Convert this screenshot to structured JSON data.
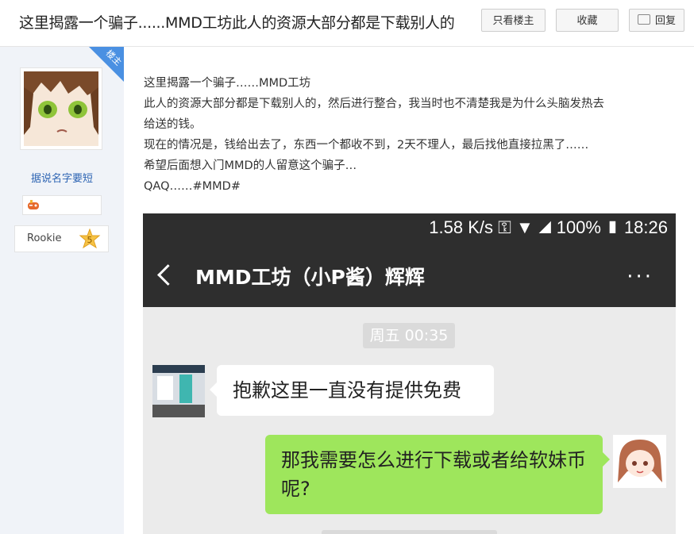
{
  "header": {
    "title": "这里揭露一个骗子......MMD工坊此人的资源大部分都是下载别人的",
    "btn_only_op": "只看楼主",
    "btn_favorite": "收藏",
    "btn_reply": "回复"
  },
  "author": {
    "corner_tag": "楼主",
    "name": "据说名字要短",
    "level_name": "Rookie",
    "level_num": "5"
  },
  "post": {
    "lines": [
      "这里揭露一个骗子……MMD工坊",
      "此人的资源大部分都是下载别人的，然后进行整合，我当时也不清楚我是为什么头脑发热去",
      "给送的钱。",
      "现在的情况是，钱给出去了，东西一个都收不到，2天不理人，最后找他直接拉黑了……",
      "希望后面想入门MMD的人留意这个骗子…",
      "QAQ……#MMD#"
    ]
  },
  "screenshot": {
    "status": "1.58 K/s ⚿ ▼ ◢ 100% ▮ 18:26",
    "chat_title": "MMD工坊（小P酱）辉辉",
    "more": "···",
    "time_label": "周五 00:35",
    "msg_left": "抱歉这里一直没有提供免费",
    "msg_right": "那我需要怎么进行下载或者给软妹币呢?"
  },
  "colors": {
    "accent_blue": "#4a90e2",
    "bubble_green": "#9ee65c",
    "link_blue": "#2d64b3",
    "sidebar_bg": "#f0f3f8"
  }
}
